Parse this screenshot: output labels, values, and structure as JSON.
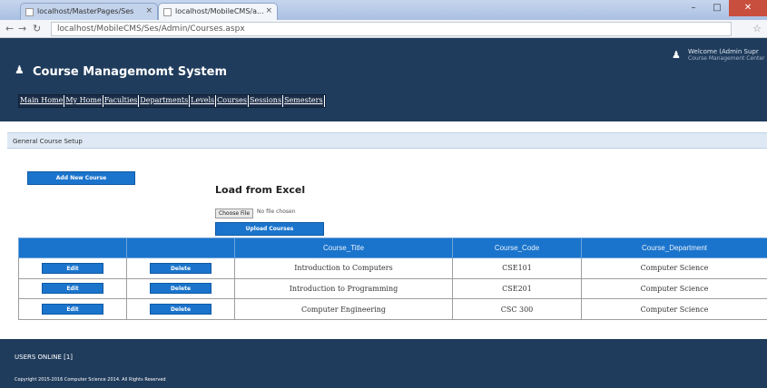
{
  "browser": {
    "tabs": [
      {
        "label": "localhost/MasterPages/Ses"
      },
      {
        "label": "localhost/MobileCMS/a..."
      }
    ],
    "url": "localhost/MobileCMS/Ses/Admin/Courses.aspx",
    "controls": {
      "minimize": "–",
      "maximize": "□",
      "close": "✕"
    }
  },
  "header": {
    "title": "Course Managemomt System",
    "user": {
      "name": "Welcome (Admin Supr",
      "role": "Course Management Center"
    }
  },
  "menu": {
    "items": [
      "Main Home",
      "My Home",
      "Faculties",
      "Departments",
      "Levels",
      "Courses",
      "Sessions",
      "Semesters"
    ]
  },
  "page": {
    "section_title": "General Course Setup",
    "add_button": "Add New Course",
    "load_title": "Load from Excel",
    "choose_file": "Choose File",
    "no_file": "No file chosen",
    "upload_button": "Upload Courses"
  },
  "table": {
    "headers": [
      "",
      "",
      "Course_Title",
      "Course_Code",
      "Course_Department"
    ],
    "edit_label": "Edit",
    "delete_label": "Delete",
    "rows": [
      {
        "title": "Introduction to Computers",
        "code": "CSE101",
        "department": "Computer Science"
      },
      {
        "title": "Introduction to Programming",
        "code": "CSE201",
        "department": "Computer Science"
      },
      {
        "title": "Computer Engineering",
        "code": "CSC 300",
        "department": "Computer Science"
      }
    ]
  },
  "footer": {
    "users_online": "USERS ONLINE [1]",
    "copyright": "Copyright 2015-2016 Computer Science 2014. All Rights Reserved"
  },
  "colors": {
    "header_bg": "#203c5c",
    "accent": "#1a74cc"
  }
}
